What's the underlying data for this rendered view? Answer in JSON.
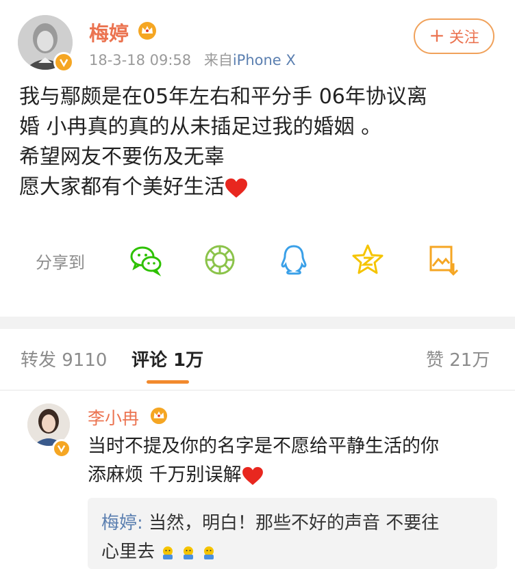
{
  "post": {
    "author": "梅婷",
    "time": "18-3-18 09:58",
    "source_prefix": "来自",
    "source": "iPhone X",
    "follow_label": "关注",
    "text_lines": [
      "我与鄢颇是在05年左右和平分手  06年协议离",
      "婚 小冉真的真的从未插足过我的婚姻 。",
      "希望网友不要伤及无辜",
      "愿大家都有个美好生活"
    ]
  },
  "share": {
    "label": "分享到",
    "icons": [
      "wechat-icon",
      "moments-icon",
      "qq-icon",
      "qzone-icon",
      "save-image-icon"
    ]
  },
  "tabs": {
    "repost": "转发 9110",
    "comment": "评论 1万",
    "like": "赞 21万"
  },
  "comment": {
    "author": "李小冉",
    "text_lines": [
      "当时不提及你的名字是不愿给平静生活的你",
      "添麻烦 千万别误解"
    ]
  },
  "reply": {
    "author": "梅婷:",
    "text_lines": [
      " 当然，明白！那些不好的声音 不要往",
      "心里去"
    ]
  },
  "colors": {
    "accent": "#eb7350",
    "link": "#5b7fb0",
    "badge": "#f5a623",
    "wechat": "#2dc100",
    "qzone": "#f5c400",
    "qq": "#3aa0e8"
  }
}
